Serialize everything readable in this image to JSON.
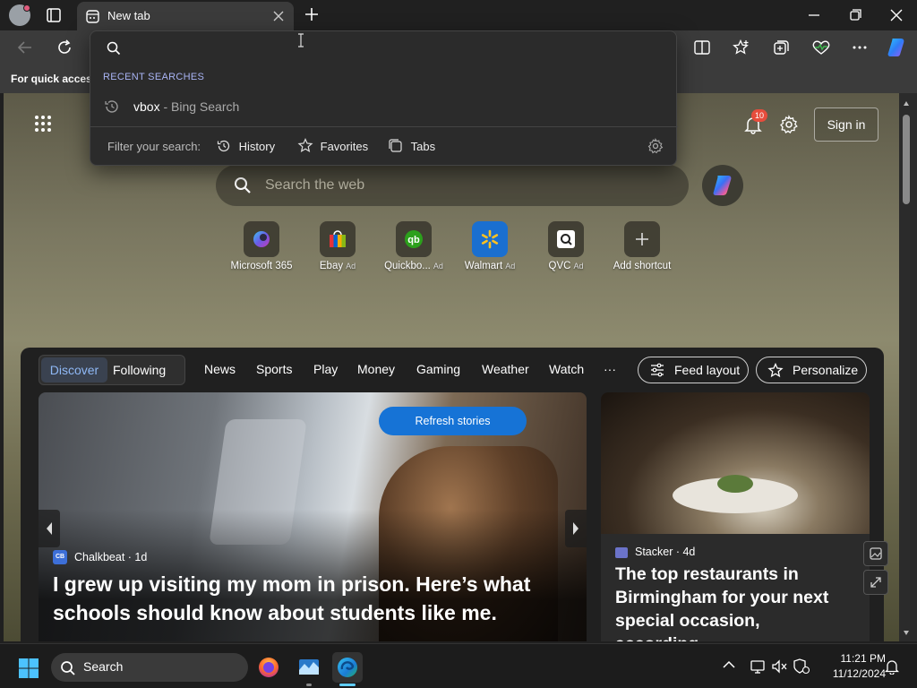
{
  "browser": {
    "tab_title": "New tab",
    "favorites_bar_text": "For quick access",
    "omnibox": {
      "query": "",
      "recent_header": "RECENT SEARCHES",
      "suggestion_term": "vbox",
      "suggestion_source": " - Bing Search",
      "filter_label": "Filter your search:",
      "filters": [
        "History",
        "Favorites",
        "Tabs"
      ]
    }
  },
  "newtab": {
    "notification_count": "10",
    "signin_label": "Sign in",
    "search_placeholder": "Search the web",
    "quick_links": [
      {
        "label": "Microsoft 365",
        "ad": ""
      },
      {
        "label": "Ebay",
        "ad": "Ad"
      },
      {
        "label": "Quickbo...",
        "ad": "Ad"
      },
      {
        "label": "Walmart",
        "ad": "Ad"
      },
      {
        "label": "QVC",
        "ad": "Ad"
      },
      {
        "label": "Add shortcut",
        "ad": ""
      }
    ]
  },
  "feed": {
    "segments": [
      "Discover",
      "Following"
    ],
    "nav": [
      "News",
      "Sports",
      "Play",
      "Money",
      "Gaming",
      "Weather",
      "Watch",
      "···"
    ],
    "feed_layout_label": "Feed layout",
    "personalize_label": "Personalize",
    "refresh_label": "Refresh stories",
    "hero": {
      "source_logo": "CB",
      "source": "Chalkbeat · 1d",
      "title": "I grew up visiting my mom in prison. Here’s what schools should know about students like me."
    },
    "side": {
      "source": "Stacker · 4d",
      "title": "The top restaurants in Birmingham for your next special occasion, according..."
    }
  },
  "taskbar": {
    "search_label": "Search",
    "time": "11:21 PM",
    "date": "11/12/2024"
  },
  "colors": {
    "accent": "#1673d6",
    "discover_text": "#8fb8f5",
    "badge": "#e74c3c"
  }
}
